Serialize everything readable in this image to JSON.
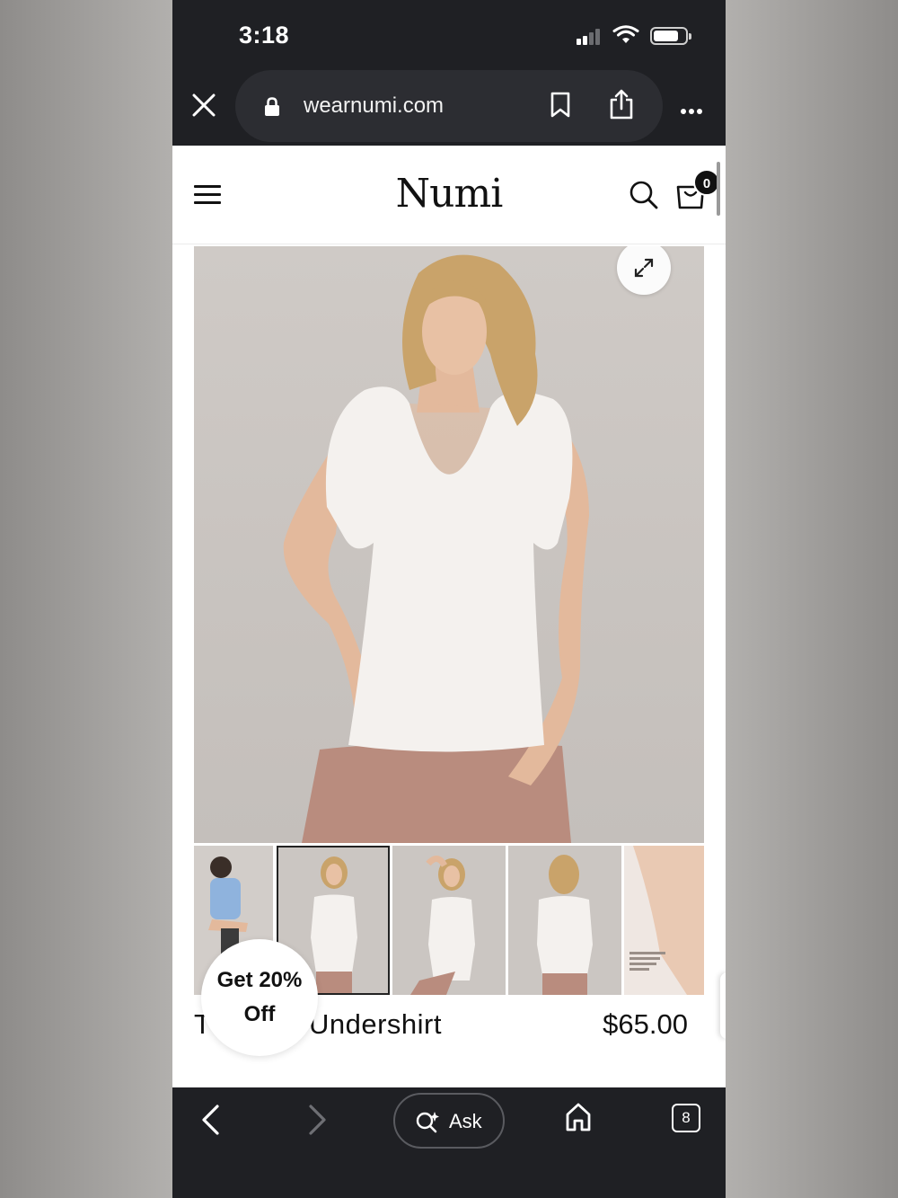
{
  "status_bar": {
    "time": "3:18"
  },
  "browser": {
    "url": "wearnumi.com",
    "tabs_count": "8",
    "ask_label": "Ask"
  },
  "site": {
    "logo": "Numi",
    "cart_count": "0"
  },
  "product": {
    "title": "The Signature Undershirt",
    "visible_title": "T      nature Undershirt",
    "price": "$65.00",
    "thumbnails": [
      "thumb-1",
      "thumb-2",
      "thumb-3",
      "thumb-4",
      "thumb-5"
    ],
    "active_thumbnail": 1
  },
  "promo": {
    "line1": "Get 20%",
    "line2": "Off"
  },
  "colors": {
    "chrome_bg": "#1f2024",
    "url_pill_bg": "#2c2d32",
    "text_dark": "#111111",
    "photo_bg": "#cbc6c2",
    "shirt": "#f4f1ee",
    "pants": "#b98c7e",
    "skin": "#e3b99c"
  }
}
